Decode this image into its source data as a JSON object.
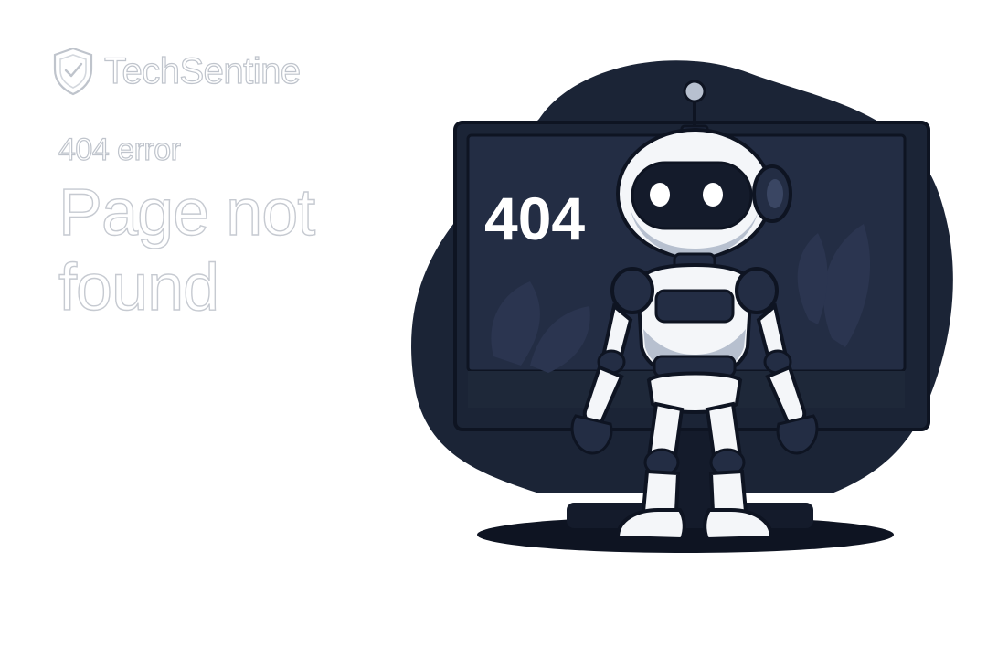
{
  "brand": {
    "name": "TechSentine",
    "logo_icon": "shield-check-icon"
  },
  "error": {
    "eyebrow": "404 error",
    "heading": "Page not found"
  },
  "illustration": {
    "screen_code": "404",
    "subject": "robot",
    "colors": {
      "navy": "#1b2436",
      "screen": "#232d44",
      "robot_white": "#f4f6f9",
      "robot_shade": "#b7c0cf",
      "outline": "#0e1422"
    }
  }
}
